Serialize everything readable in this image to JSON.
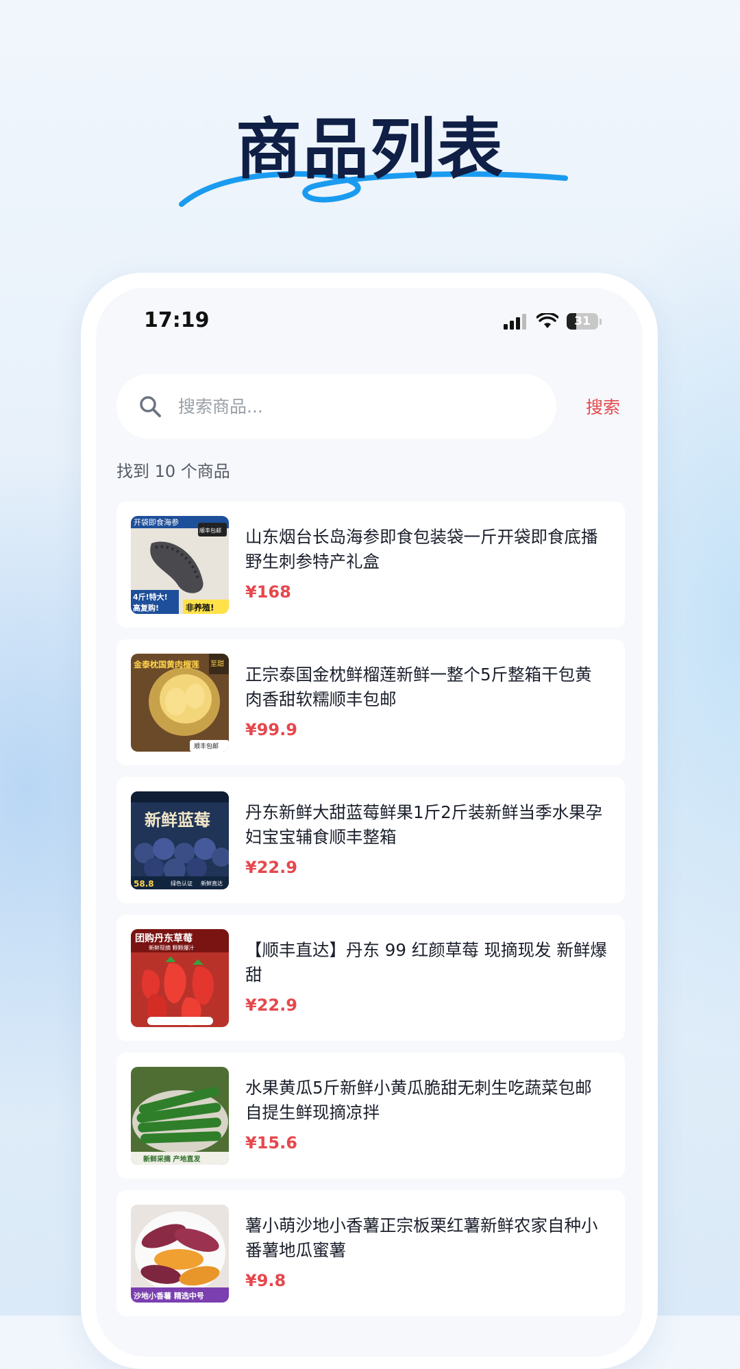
{
  "hero": {
    "title": "商品列表"
  },
  "status_bar": {
    "time": "17:19",
    "battery": "31",
    "battery_level": 0.31
  },
  "search": {
    "placeholder": "搜索商品...",
    "value": "",
    "button_label": "搜索"
  },
  "result_count": "找到 10 个商品",
  "products": [
    {
      "title": "山东烟台长岛海参即食包装袋一斤开袋即食底播野生刺参特产礼盒",
      "price": "¥168",
      "image_icon": "sea-cucumber-image",
      "badges": [
        "开袋即食海参",
        "顺丰包邮",
        "4斤!特大!",
        "高复购!",
        "非养殖!"
      ]
    },
    {
      "title": "正宗泰国金枕鲜榴莲新鲜一整个5斤整箱干包黄肉香甜软糯顺丰包邮",
      "price": "¥99.9",
      "image_icon": "durian-image",
      "badges": [
        "金泰枕国黄肉榴莲",
        "至甜",
        "顺丰包邮"
      ]
    },
    {
      "title": "丹东新鲜大甜蓝莓鲜果1斤2斤装新鲜当季水果孕妇宝宝辅食顺丰整箱",
      "price": "¥22.9",
      "image_icon": "blueberry-image",
      "badges": [
        "新鲜蓝莓",
        "58.8",
        "绿色认证",
        "新鲜直达"
      ]
    },
    {
      "title": "【顺丰直达】丹东 99 红颜草莓 现摘现发 新鲜爆甜",
      "price": "¥22.9",
      "image_icon": "strawberry-image",
      "badges": [
        "团购丹东草莓",
        "新鲜现摘 颗颗爆汁"
      ]
    },
    {
      "title": "水果黄瓜5斤新鲜小黄瓜脆甜无刺生吃蔬菜包邮自提生鲜现摘凉拌",
      "price": "¥15.6",
      "image_icon": "cucumber-image",
      "badges": [
        "新鲜采摘 产地直发"
      ]
    },
    {
      "title": "薯小萌沙地小香薯正宗板栗红薯新鲜农家自种小番薯地瓜蜜薯",
      "price": "¥9.8",
      "image_icon": "sweet-potato-image",
      "badges": [
        "沙地小香薯 精选中号"
      ]
    }
  ],
  "colors": {
    "accent": "#e5484d",
    "title": "#0f1f45",
    "swoosh": "#1a9bf0",
    "card_bg": "#ffffff",
    "screen_bg": "#f6f8fb"
  }
}
